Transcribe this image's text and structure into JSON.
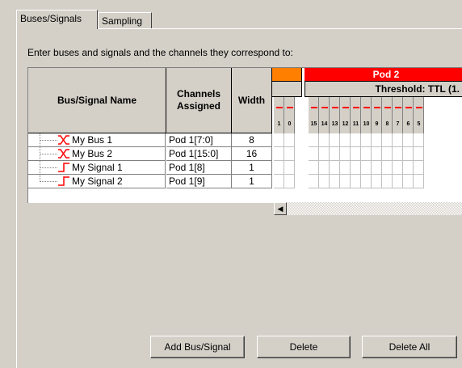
{
  "tabs": [
    {
      "label": "Buses/Signals",
      "active": true
    },
    {
      "label": "Sampling",
      "active": false
    }
  ],
  "instruction": "Enter buses and signals and the channels they correspond to:",
  "grid": {
    "headers": {
      "name": "Bus/Signal Name",
      "channels_line1": "Channels",
      "channels_line2": "Assigned",
      "width": "Width"
    },
    "pod_label": "Pod 2",
    "threshold_label": "Threshold: TTL (1.",
    "pod1_channel_numbers": [
      "1",
      "0"
    ],
    "pod2_channel_numbers": [
      "15",
      "14",
      "13",
      "12",
      "11",
      "10",
      "9",
      "8",
      "7",
      "6",
      "5"
    ],
    "rows": [
      {
        "name": "My Bus 1",
        "type": "bus",
        "channels": "Pod 1[7:0]",
        "width": "8"
      },
      {
        "name": "My Bus 2",
        "type": "bus",
        "channels": "Pod 1[15:0]",
        "width": "16"
      },
      {
        "name": "My Signal 1",
        "type": "signal",
        "channels": "Pod 1[8]",
        "width": "1"
      },
      {
        "name": "My Signal 2",
        "type": "signal",
        "channels": "Pod 1[9]",
        "width": "1"
      }
    ]
  },
  "buttons": {
    "add": "Add Bus/Signal",
    "delete": "Delete",
    "delete_all": "Delete All"
  },
  "colors": {
    "pod1": "#ff8000",
    "pod2": "#ff0000",
    "dash": "#ff0000"
  },
  "icons": {
    "bus": "bus-icon",
    "signal": "signal-icon",
    "scroll_left": "left-arrow-icon"
  }
}
